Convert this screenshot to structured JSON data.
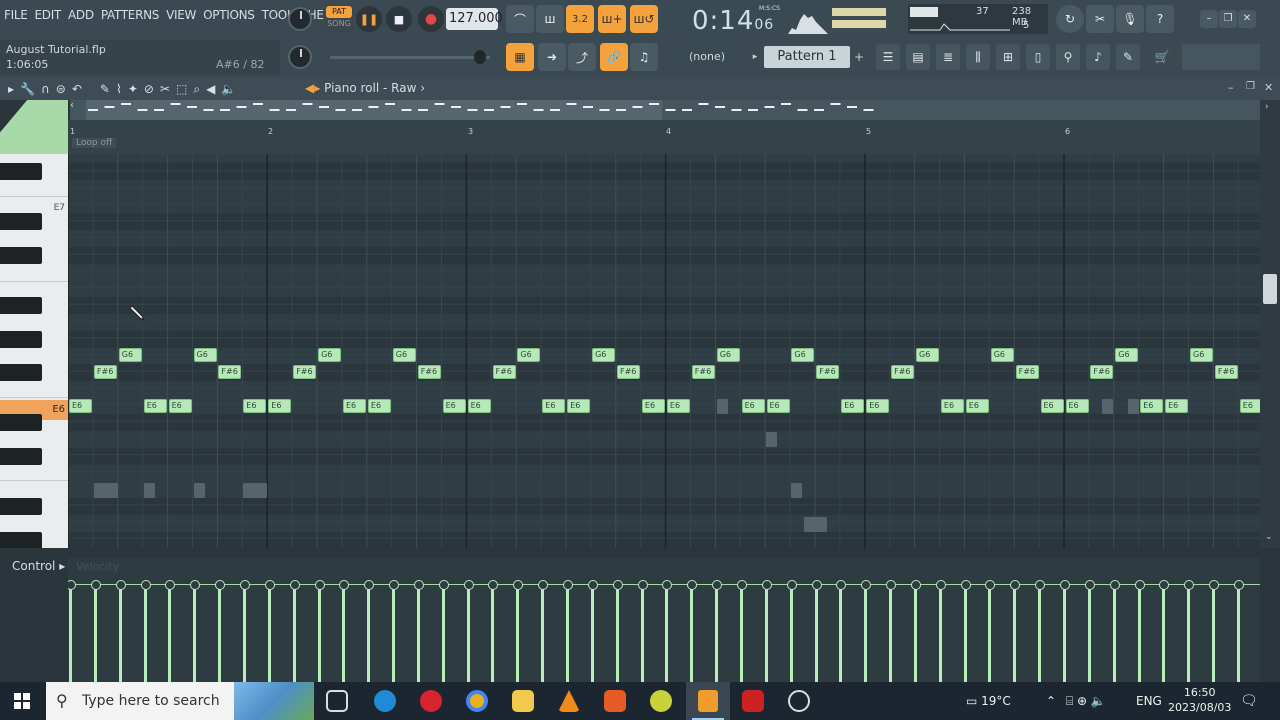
{
  "menu": [
    "FILE",
    "EDIT",
    "ADD",
    "PATTERNS",
    "VIEW",
    "OPTIONS",
    "TOOLS",
    "HELP"
  ],
  "transport": {
    "pat_label": "PAT",
    "song_label": "SONG",
    "tempo": "127.000"
  },
  "time_display": {
    "value": "0:14",
    "sub": "06",
    "format": "M:S:CS"
  },
  "cpu": {
    "value": "37",
    "memory": "238 MB",
    "polyphony": "5"
  },
  "song": {
    "file": "August Tutorial.flp",
    "position": "1:06:05",
    "hint": "A#6 / 82"
  },
  "snap": "(none)",
  "pattern": "Pattern 1",
  "piano_roll": {
    "title": "Piano roll - Raw",
    "loop": "Loop off",
    "bars": [
      "1",
      "2",
      "3",
      "4",
      "5",
      "6"
    ]
  },
  "keys": {
    "e7": "E7",
    "e6": "E6"
  },
  "control": {
    "label": "Control",
    "target": "Velocity"
  },
  "notes": [
    {
      "n": "E6"
    },
    {
      "n": "F#6"
    },
    {
      "n": "G6"
    },
    {
      "n": "E6"
    },
    {
      "n": "E6"
    },
    {
      "n": "G6"
    },
    {
      "n": "F#6"
    },
    {
      "n": "E6"
    },
    {
      "n": "E6"
    },
    {
      "n": "F#6"
    },
    {
      "n": "G6"
    },
    {
      "n": "E6"
    },
    {
      "n": "E6"
    },
    {
      "n": "G6"
    },
    {
      "n": "F#6"
    },
    {
      "n": "E6"
    },
    {
      "n": "E6"
    },
    {
      "n": "F#6"
    },
    {
      "n": "G6"
    },
    {
      "n": "E6"
    },
    {
      "n": "E6"
    },
    {
      "n": "G6"
    },
    {
      "n": "F#6"
    },
    {
      "n": "E6"
    },
    {
      "n": "E6"
    },
    {
      "n": "F#6"
    },
    {
      "n": "G6"
    },
    {
      "n": "E6"
    },
    {
      "n": "E6"
    },
    {
      "n": "G6"
    },
    {
      "n": "F#6"
    },
    {
      "n": "E6"
    },
    {
      "n": "E6"
    },
    {
      "n": "F#6"
    },
    {
      "n": "G6"
    },
    {
      "n": "E6"
    },
    {
      "n": "E6"
    },
    {
      "n": "G6"
    },
    {
      "n": "F#6"
    },
    {
      "n": "E6"
    },
    {
      "n": "E6"
    },
    {
      "n": "F#6"
    },
    {
      "n": "G6"
    },
    {
      "n": "E6"
    },
    {
      "n": "E6"
    },
    {
      "n": "G6"
    },
    {
      "n": "F#6"
    },
    {
      "n": "E6"
    }
  ],
  "taskbar": {
    "search_placeholder": "Type here to search",
    "weather": "19°C",
    "lang": "ENG",
    "time": "16:50",
    "date": "2023/08/03"
  }
}
